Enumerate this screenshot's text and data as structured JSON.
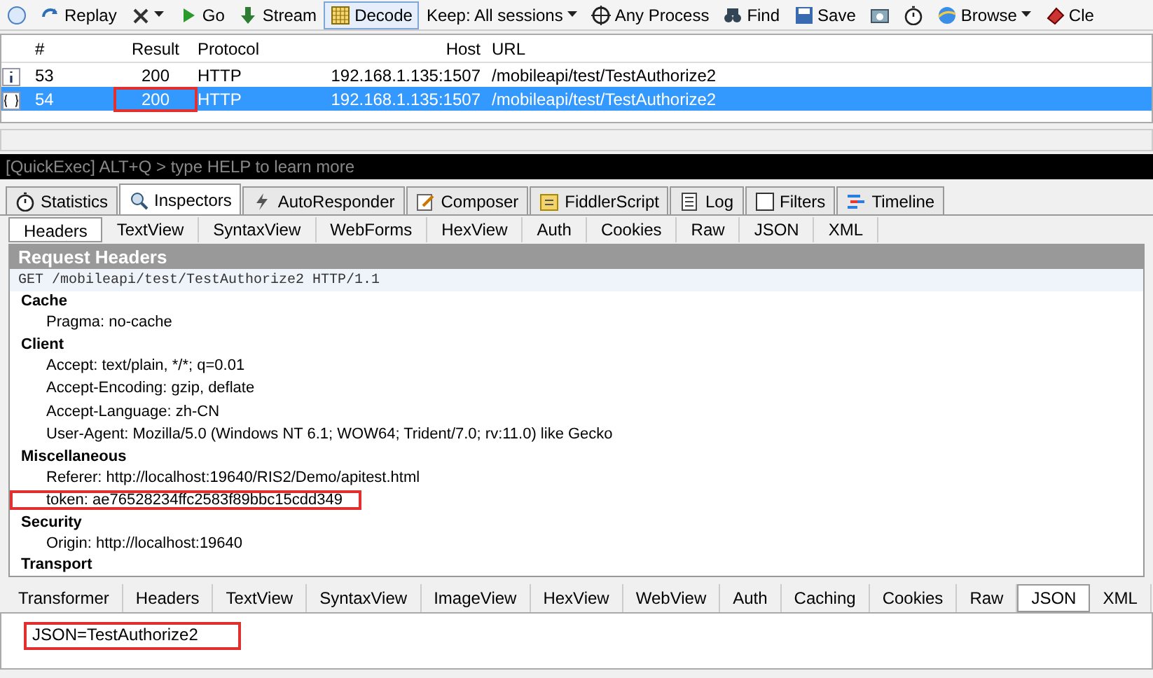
{
  "toolbar": [
    {
      "kind": "icon"
    },
    {
      "kind": "button",
      "label": "Replay"
    },
    {
      "kind": "dropdown"
    },
    {
      "kind": "button",
      "label": "Go"
    },
    {
      "kind": "button",
      "label": "Stream"
    },
    {
      "kind": "toggle",
      "label": "Decode",
      "selected": true
    },
    {
      "kind": "dropdown",
      "label": "Keep: All sessions"
    },
    {
      "kind": "button",
      "label": "Any Process"
    },
    {
      "kind": "button",
      "label": "Find"
    },
    {
      "kind": "button",
      "label": "Save"
    },
    {
      "kind": "icon"
    },
    {
      "kind": "icon"
    },
    {
      "kind": "dropdown",
      "label": "Browse"
    },
    {
      "kind": "button",
      "label": "Cle"
    }
  ],
  "sessions": {
    "columns": [
      "#",
      "Result",
      "Protocol",
      "Host",
      "URL"
    ],
    "rows": [
      {
        "id": "53",
        "result": "200",
        "protocol": "HTTP",
        "host": "192.168.1.135:1507",
        "url": "/mobileapi/test/TestAuthorize2",
        "selected": false,
        "highlighted": false
      },
      {
        "id": "54",
        "result": "200",
        "protocol": "HTTP",
        "host": "192.168.1.135:1507",
        "url": "/mobileapi/test/TestAuthorize2",
        "selected": true,
        "highlighted": true
      }
    ]
  },
  "quickexec": {
    "placeholder": "[QuickExec] ALT+Q > type HELP to learn more"
  },
  "tabs": [
    {
      "label": "Statistics",
      "selected": false
    },
    {
      "label": "Inspectors",
      "selected": true
    },
    {
      "label": "AutoResponder",
      "selected": false
    },
    {
      "label": "Composer",
      "selected": false
    },
    {
      "label": "FiddlerScript",
      "selected": false
    },
    {
      "label": "Log",
      "selected": false
    },
    {
      "label": "Filters",
      "selected": false
    },
    {
      "label": "Timeline",
      "selected": false
    }
  ],
  "request_tabs": [
    {
      "label": "Headers",
      "selected": true
    },
    {
      "label": "TextView",
      "selected": false
    },
    {
      "label": "SyntaxView",
      "selected": false
    },
    {
      "label": "WebForms",
      "selected": false
    },
    {
      "label": "HexView",
      "selected": false
    },
    {
      "label": "Auth",
      "selected": false
    },
    {
      "label": "Cookies",
      "selected": false
    },
    {
      "label": "Raw",
      "selected": false
    },
    {
      "label": "JSON",
      "selected": false
    },
    {
      "label": "XML",
      "selected": false
    }
  ],
  "request_headers": {
    "title": "Request Headers",
    "request_line": "GET /mobileapi/test/TestAuthorize2 HTTP/1.1",
    "groups": [
      {
        "name": "Cache",
        "headers": [
          {
            "text": "Pragma: no-cache",
            "highlighted": false
          }
        ]
      },
      {
        "name": "Client",
        "headers": [
          {
            "text": "Accept: text/plain, */*; q=0.01",
            "highlighted": false
          },
          {
            "text": "Accept-Encoding: gzip, deflate",
            "highlighted": false
          },
          {
            "text": "Accept-Language: zh-CN",
            "highlighted": false
          },
          {
            "text": "User-Agent: Mozilla/5.0 (Windows NT 6.1; WOW64; Trident/7.0; rv:11.0) like Gecko",
            "highlighted": false
          }
        ]
      },
      {
        "name": "Miscellaneous",
        "headers": [
          {
            "text": "Referer: http://localhost:19640/RIS2/Demo/apitest.html",
            "highlighted": false
          },
          {
            "text": "token: ae76528234ffc2583f89bbc15cdd349",
            "highlighted": true
          }
        ]
      },
      {
        "name": "Security",
        "headers": [
          {
            "text": "Origin: http://localhost:19640",
            "highlighted": false
          }
        ]
      },
      {
        "name": "Transport"
      }
    ]
  },
  "response_tabs": [
    {
      "label": "Transformer",
      "selected": false
    },
    {
      "label": "Headers",
      "selected": false
    },
    {
      "label": "TextView",
      "selected": false
    },
    {
      "label": "SyntaxView",
      "selected": false
    },
    {
      "label": "ImageView",
      "selected": false
    },
    {
      "label": "HexView",
      "selected": false
    },
    {
      "label": "WebView",
      "selected": false
    },
    {
      "label": "Auth",
      "selected": false
    },
    {
      "label": "Caching",
      "selected": false
    },
    {
      "label": "Cookies",
      "selected": false
    },
    {
      "label": "Raw",
      "selected": false
    },
    {
      "label": "JSON",
      "selected": true
    },
    {
      "label": "XML",
      "selected": false
    }
  ],
  "json_tree": [
    {
      "text": "JSON=TestAuthorize2",
      "highlighted": true
    }
  ]
}
